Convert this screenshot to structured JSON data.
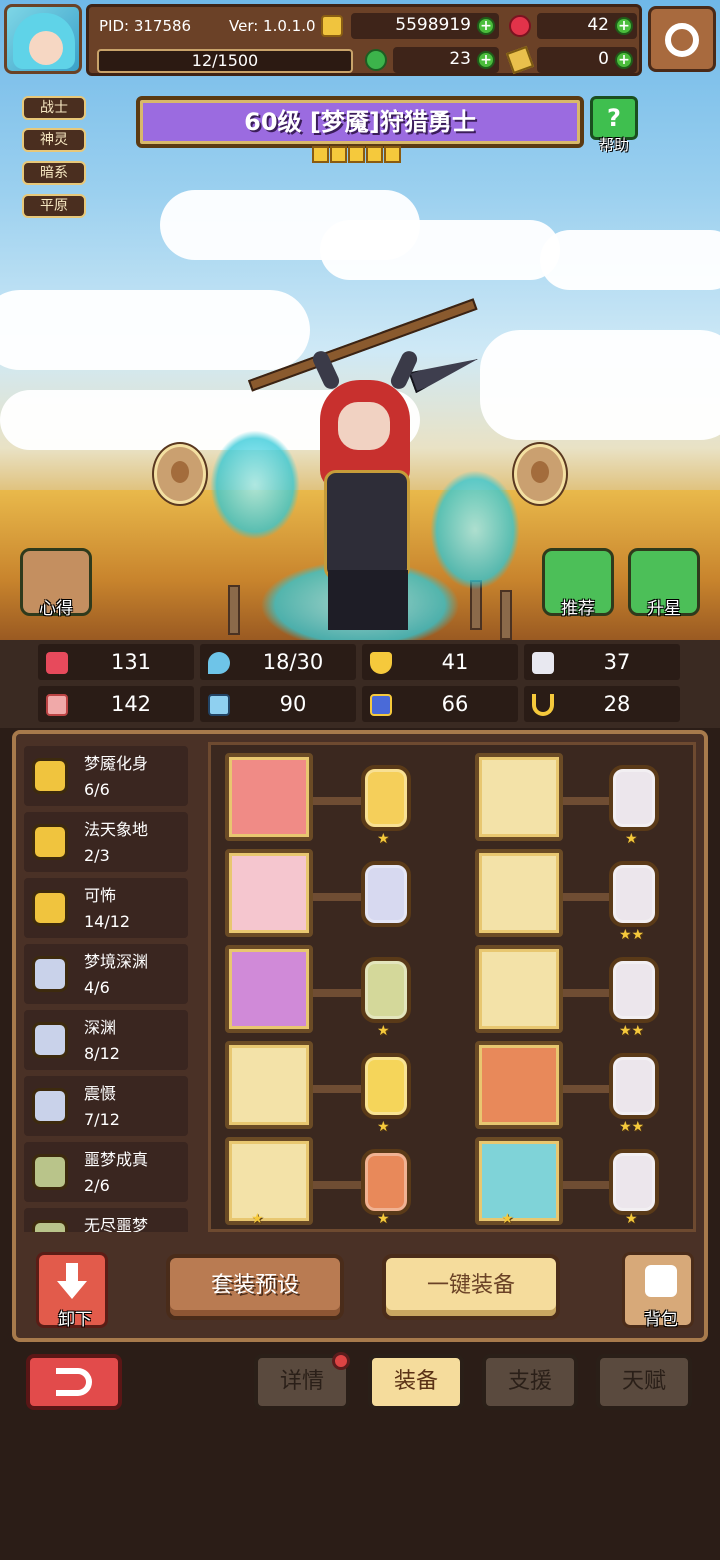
{
  "header": {
    "pid": "PID: 317586",
    "version": "Ver: 1.0.1.0",
    "xp": "12/1500",
    "gold": "5598919",
    "ruby": "42",
    "clover": "23",
    "ticket": "0"
  },
  "tags": [
    "战士",
    "神灵",
    "暗系",
    "平原"
  ],
  "title": "60级 [梦魇]狩猎勇士",
  "star_count": 5,
  "buttons": {
    "help": "帮助",
    "insight": "心得",
    "recommend": "推荐",
    "star_up": "升星",
    "unload": "卸下",
    "preset": "套装预设",
    "one_click": "一键装备",
    "bag": "背包"
  },
  "stats": [
    "131",
    "18/30",
    "41",
    "37",
    "142",
    "90",
    "66",
    "28"
  ],
  "sets": [
    {
      "name": "梦魇化身",
      "count": "6/6"
    },
    {
      "name": "法天象地",
      "count": "2/3"
    },
    {
      "name": "可怖",
      "count": "14/12"
    },
    {
      "name": "梦境深渊",
      "count": "4/6"
    },
    {
      "name": "深渊",
      "count": "8/12"
    },
    {
      "name": "震慑",
      "count": "7/12"
    },
    {
      "name": "噩梦成真",
      "count": "2/6"
    },
    {
      "name": "无尽噩梦",
      "count": ""
    }
  ],
  "tabs": [
    {
      "label": "详情"
    },
    {
      "label": "装备"
    },
    {
      "label": "支援"
    },
    {
      "label": "天赋"
    }
  ],
  "colors": {
    "accent_gold": "#f5dc9c",
    "panel_brown": "#4a3126",
    "banner_purple": "#9b6be0"
  }
}
